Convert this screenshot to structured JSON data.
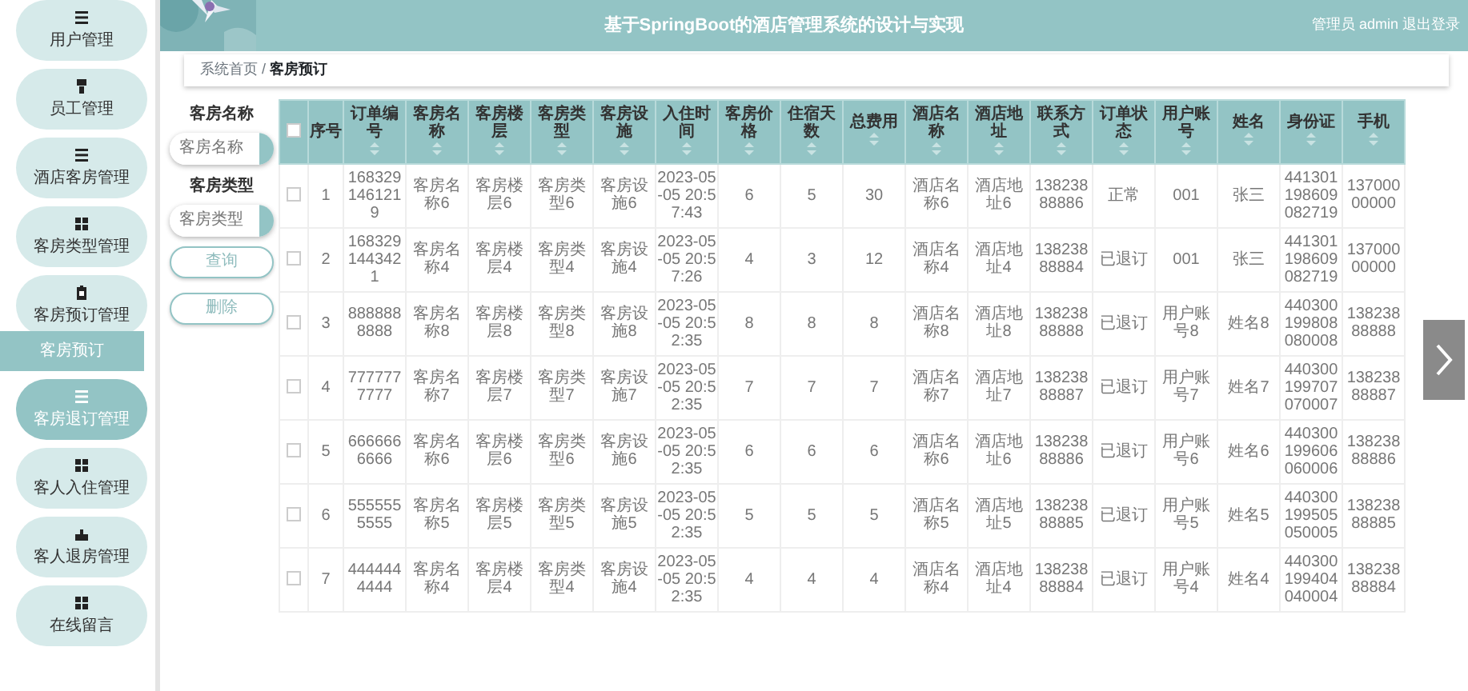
{
  "header": {
    "title": "基于SpringBoot的酒店管理系统的设计与实现",
    "user": "管理员 admin",
    "logout": "退出登录"
  },
  "sidebar": {
    "items": [
      {
        "label": "用户管理",
        "kind": "bars",
        "selected": false
      },
      {
        "label": "员工管理",
        "kind": "person",
        "selected": false
      },
      {
        "label": "酒店客房管理",
        "kind": "bars",
        "selected": false
      },
      {
        "label": "客房类型管理",
        "kind": "grid",
        "selected": false
      },
      {
        "label": "客房预订管理",
        "kind": "clipboard",
        "selected": false,
        "expanded": true,
        "children": [
          {
            "label": "客房预订"
          }
        ]
      },
      {
        "label": "客房退订管理",
        "kind": "bars",
        "selected": true
      },
      {
        "label": "客人入住管理",
        "kind": "grid",
        "selected": false
      },
      {
        "label": "客人退房管理",
        "kind": "hand",
        "selected": false
      },
      {
        "label": "在线留言",
        "kind": "grid",
        "selected": false
      }
    ]
  },
  "breadcrumb": {
    "separator": "/",
    "items": [
      "系统首页",
      "客房预订"
    ]
  },
  "filters": [
    {
      "label": "客房名称",
      "placeholder": "客房名称"
    },
    {
      "label": "客房类型",
      "placeholder": "客房类型"
    }
  ],
  "buttons": [
    "查询",
    "删除"
  ],
  "table": {
    "all_checked": false,
    "columns": [
      {
        "label": "序号",
        "sortable": false
      },
      {
        "label": "订单编号",
        "sortable": true
      },
      {
        "label": "客房名称",
        "sortable": true
      },
      {
        "label": "客房楼层",
        "sortable": true
      },
      {
        "label": "客房类型",
        "sortable": true
      },
      {
        "label": "客房设施",
        "sortable": true
      },
      {
        "label": "入住时间",
        "sortable": true
      },
      {
        "label": "客房价格",
        "sortable": true
      },
      {
        "label": "住宿天数",
        "sortable": true
      },
      {
        "label": "总费用",
        "sortable": true
      },
      {
        "label": "酒店名称",
        "sortable": true
      },
      {
        "label": "酒店地址",
        "sortable": true
      },
      {
        "label": "联系方式",
        "sortable": true
      },
      {
        "label": "订单状态",
        "sortable": true
      },
      {
        "label": "用户账号",
        "sortable": true
      },
      {
        "label": "姓名",
        "sortable": true
      },
      {
        "label": "身份证",
        "sortable": true
      },
      {
        "label": "手机",
        "sortable": true
      }
    ],
    "rows": [
      {
        "checked": false,
        "cells": [
          "1",
          "1683291461219",
          "客房名称6",
          "客房楼层6",
          "客房类型6",
          "客房设施6",
          "2023-05-05 20:57:43",
          "6",
          "5",
          "30",
          "酒店名称6",
          "酒店地址6",
          "13823888886",
          "正常",
          "001",
          "张三",
          "441301198609082719",
          "13700000000"
        ]
      },
      {
        "checked": false,
        "cells": [
          "2",
          "1683291443421",
          "客房名称4",
          "客房楼层4",
          "客房类型4",
          "客房设施4",
          "2023-05-05 20:57:26",
          "4",
          "3",
          "12",
          "酒店名称4",
          "酒店地址4",
          "13823888884",
          "已退订",
          "001",
          "张三",
          "441301198609082719",
          "13700000000"
        ]
      },
      {
        "checked": false,
        "cells": [
          "3",
          "8888888888",
          "客房名称8",
          "客房楼层8",
          "客房类型8",
          "客房设施8",
          "2023-05-05 20:52:35",
          "8",
          "8",
          "8",
          "酒店名称8",
          "酒店地址8",
          "13823888888",
          "已退订",
          "用户账号8",
          "姓名8",
          "440300199808080008",
          "13823888888"
        ]
      },
      {
        "checked": false,
        "cells": [
          "4",
          "7777777777",
          "客房名称7",
          "客房楼层7",
          "客房类型7",
          "客房设施7",
          "2023-05-05 20:52:35",
          "7",
          "7",
          "7",
          "酒店名称7",
          "酒店地址7",
          "13823888887",
          "已退订",
          "用户账号7",
          "姓名7",
          "440300199707070007",
          "13823888887"
        ]
      },
      {
        "checked": false,
        "cells": [
          "5",
          "6666666666",
          "客房名称6",
          "客房楼层6",
          "客房类型6",
          "客房设施6",
          "2023-05-05 20:52:35",
          "6",
          "6",
          "6",
          "酒店名称6",
          "酒店地址6",
          "13823888886",
          "已退订",
          "用户账号6",
          "姓名6",
          "440300199606060006",
          "13823888886"
        ]
      },
      {
        "checked": false,
        "cells": [
          "6",
          "5555555555",
          "客房名称5",
          "客房楼层5",
          "客房类型5",
          "客房设施5",
          "2023-05-05 20:52:35",
          "5",
          "5",
          "5",
          "酒店名称5",
          "酒店地址5",
          "13823888885",
          "已退订",
          "用户账号5",
          "姓名5",
          "440300199505050005",
          "13823888885"
        ]
      },
      {
        "checked": false,
        "cells": [
          "7",
          "4444444444",
          "客房名称4",
          "客房楼层4",
          "客房类型4",
          "客房设施4",
          "2023-05-05 20:52:35",
          "4",
          "4",
          "4",
          "酒店名称4",
          "酒店地址4",
          "13823888884",
          "已退订",
          "用户账号4",
          "姓名4",
          "440300199404040004",
          "13823888884"
        ]
      }
    ]
  }
}
